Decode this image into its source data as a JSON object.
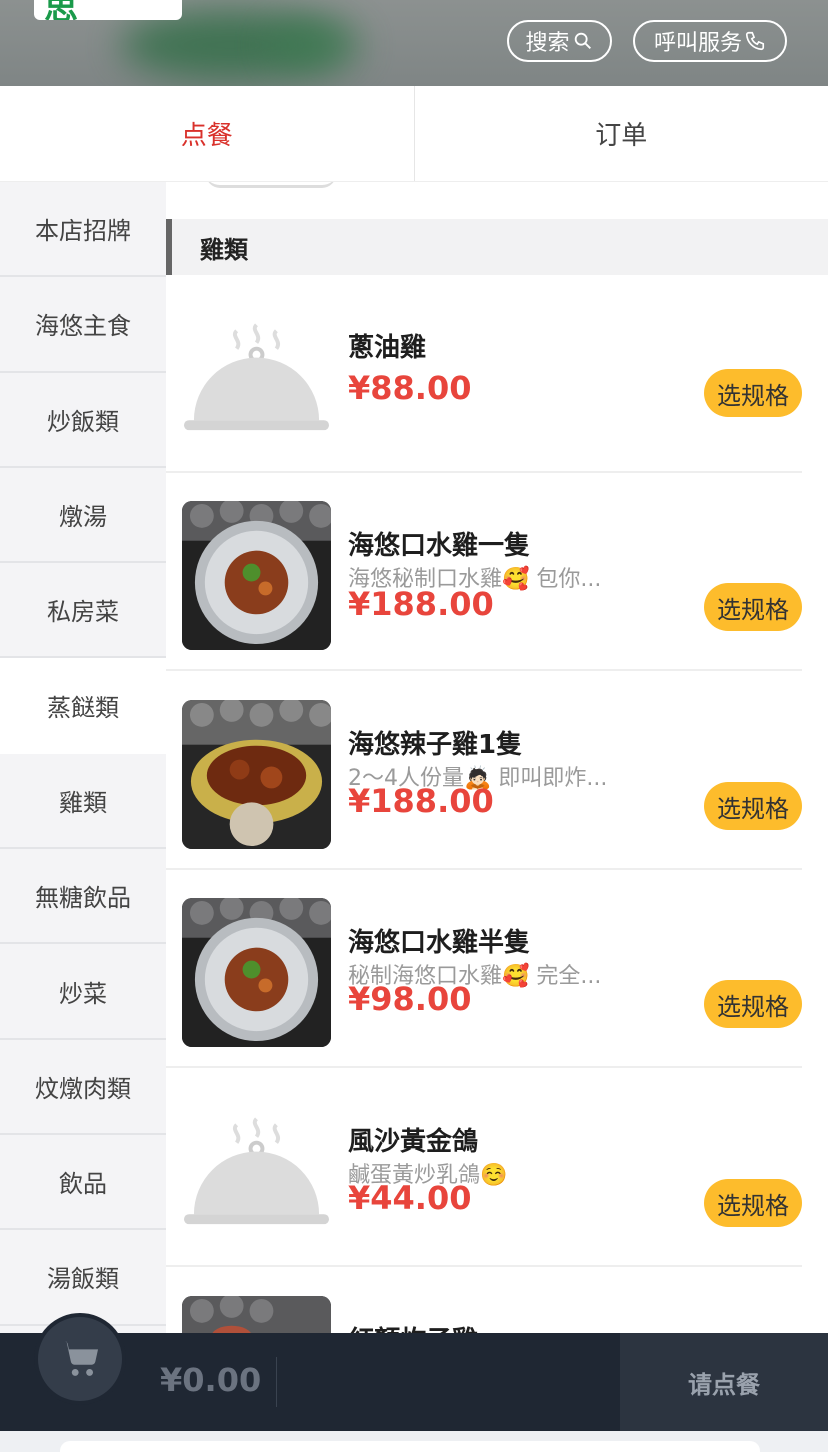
{
  "header": {
    "logo_text": "思",
    "search_label": "搜索",
    "call_label": "呼叫服务"
  },
  "tabs": [
    {
      "label": "点餐",
      "active": true
    },
    {
      "label": "订单",
      "active": false
    }
  ],
  "sidebar": {
    "categories": [
      {
        "label": "本店招牌"
      },
      {
        "label": "海悠主食"
      },
      {
        "label": "炒飯類"
      },
      {
        "label": "燉湯"
      },
      {
        "label": "私房菜"
      },
      {
        "label": "蒸餸類",
        "active": true
      },
      {
        "label": "雞類"
      },
      {
        "label": "無糖飲品"
      },
      {
        "label": "炒菜"
      },
      {
        "label": "炆燉肉類"
      },
      {
        "label": "飲品"
      },
      {
        "label": "湯飯類"
      }
    ]
  },
  "section": {
    "title": "雞類"
  },
  "items": [
    {
      "name": "蔥油雞",
      "desc": "",
      "price": "¥88.00",
      "button": "选规格",
      "image": "placeholder-cloche"
    },
    {
      "name": "海悠口水雞一隻",
      "desc": "海悠秘制口水雞🥰 包你...",
      "price": "¥188.00",
      "button": "选规格",
      "image": "photo-dish"
    },
    {
      "name": "海悠辣子雞1隻",
      "desc": "2～4人份量🙇🏻 即叫即炸...",
      "price": "¥188.00",
      "button": "选规格",
      "image": "photo-fried"
    },
    {
      "name": "海悠口水雞半隻",
      "desc": "秘制海悠口水雞🥰 完全...",
      "price": "¥98.00",
      "button": "选规格",
      "image": "photo-dish"
    },
    {
      "name": "風沙黃金鴿",
      "desc": "鹹蛋黃炒乳鴿☺️",
      "price": "¥44.00",
      "button": "选规格",
      "image": "placeholder-cloche"
    },
    {
      "name": "紅顏炸子雞",
      "desc": "",
      "price": "",
      "button": "",
      "image": "photo-dish"
    }
  ],
  "cart": {
    "total": "¥0.00",
    "checkout_label": "请点餐",
    "icon": "cart-icon"
  },
  "colors": {
    "accent_red": "#d9312b",
    "price_red": "#e8453c",
    "button_yellow": "#fdbc2c",
    "bar_dark": "#1f2733"
  }
}
